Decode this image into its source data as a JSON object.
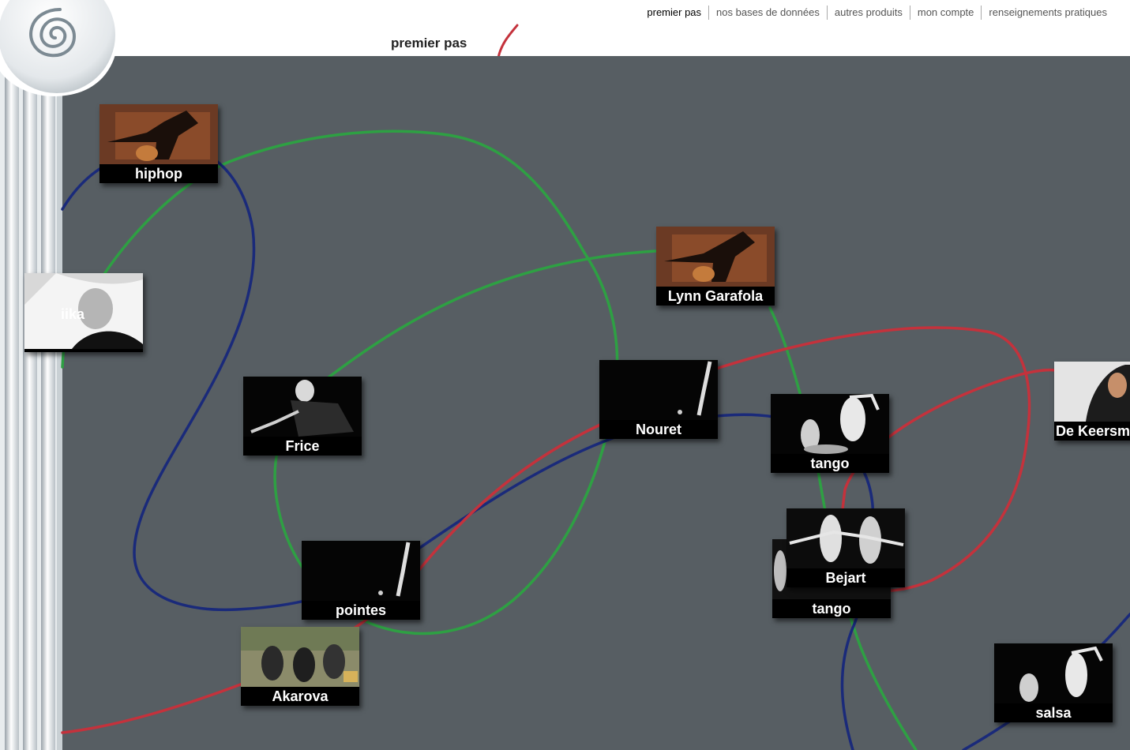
{
  "nav": {
    "items": [
      {
        "label": "premier pas",
        "active": true
      },
      {
        "label": "nos bases de données"
      },
      {
        "label": "autres produits"
      },
      {
        "label": "mon compte"
      },
      {
        "label": "renseignements pratiques"
      }
    ]
  },
  "page_title": "premier pas",
  "link_colors": {
    "green": "#2ea043",
    "blue": "#1a2a7a",
    "red": "#c4323c"
  },
  "nodes": [
    {
      "label": "hiphop",
      "thumb": "dancer-orange"
    },
    {
      "label": "iika",
      "thumb": "bw-portrait"
    },
    {
      "label": "Frice",
      "thumb": "bw-performer"
    },
    {
      "label": "pointes",
      "thumb": "ballet-pointe"
    },
    {
      "label": "Akarova",
      "thumb": "outdoor-group"
    },
    {
      "label": "Lynn Garafola",
      "thumb": "dancer-orange"
    },
    {
      "label": "Nouret",
      "thumb": "ballet-pointe"
    },
    {
      "label": "tango",
      "thumb": "couple-dancing"
    },
    {
      "label": "De Keersm",
      "thumb": "bw-portrait"
    },
    {
      "label": "tango",
      "thumb": "couple-dancing"
    },
    {
      "label": "Bejart",
      "thumb": "couple-dancing"
    },
    {
      "label": "salsa",
      "thumb": "couple-dancing"
    }
  ]
}
